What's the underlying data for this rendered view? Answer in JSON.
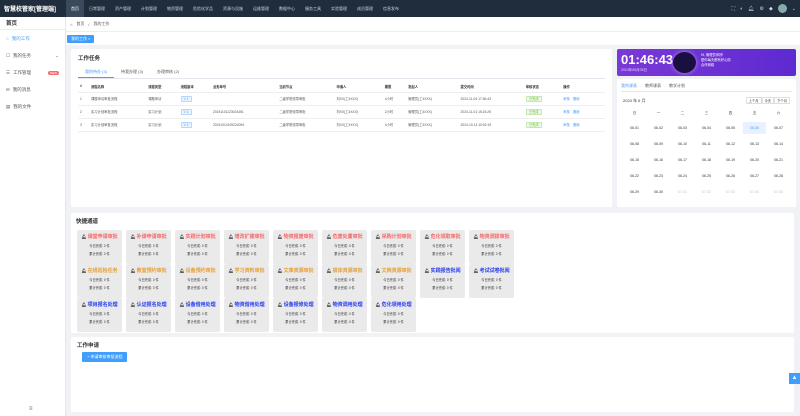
{
  "app": {
    "brand": "智慧校管家[管理端]"
  },
  "nav": [
    "首页",
    "日常管理",
    "资产管理",
    "计划管理",
    "物资管理",
    "危险化学品",
    "资源与设施",
    "运维管理",
    "数据中心",
    "服务工具",
    "实验管理",
    "成员管理",
    "信息发布"
  ],
  "sidebar": {
    "header": "首页",
    "items": [
      {
        "label": "我的工作"
      },
      {
        "label": "我的任务"
      },
      {
        "label": "工作管理",
        "badge": "NEW"
      },
      {
        "label": "我的消息"
      },
      {
        "label": "我的文件"
      }
    ]
  },
  "crumb": {
    "home": "首页",
    "current": "我的工作"
  },
  "tabbar": {
    "active": "我的工作"
  },
  "tasks": {
    "title": "工作任务",
    "tabs": [
      "我的待办 (3)",
      "待我办理 (3)",
      "办理审核 (2)"
    ],
    "columns": [
      "#",
      "流程名称",
      "流程类型",
      "流程版本",
      "业务单号",
      "当前节点",
      "申请人",
      "期限",
      "发起人",
      "提交时间",
      "审核状态",
      "操作"
    ],
    "rows": [
      [
        "1",
        "课题申请审批流程",
        "课题申请",
        "V 1",
        "",
        "二级学院领导审批",
        "刘XX(工4XXX)",
        "4小时",
        "管理员(工4XXX)",
        "2024-11-04 17:36:43",
        "已完成",
        "审核",
        "撤销"
      ],
      [
        "2",
        "实习计划审批流程",
        "实习计划",
        "V 2",
        "20241101123024451",
        "二级学院领导审批",
        "刘XX(工4XXX)",
        "2小时",
        "管理员(工4XXX)",
        "2024-11-01 15:24:25",
        "已完成",
        "审核",
        "撤销"
      ],
      [
        "3",
        "实习计划审批流程",
        "实习计划",
        "V 2",
        "20241014105224094",
        "二级学院领导审批",
        "刘XX(工4XXX)",
        "4小时",
        "管理员(工4XXX)",
        "2024-10-14 10:52:19",
        "已完成",
        "审核",
        "撤销"
      ]
    ]
  },
  "clock": {
    "time": "01:46:43",
    "date": "2024年06月05日",
    "greeting": "Hi, 管理员你好!",
    "sub1": "愿你每天都有好心情",
    "sub2": "合作网络"
  },
  "calendar": {
    "tabs": [
      "我的课表",
      "教师课表",
      "教学计划"
    ],
    "month": "2024 年 6 月",
    "buttons": [
      "上个月",
      "今天",
      "下个月"
    ],
    "weekdays": [
      "日",
      "一",
      "二",
      "三",
      "四",
      "五",
      "六"
    ],
    "rows": [
      [
        "06-01",
        "06-02",
        "06-03",
        "06-04",
        "06-05",
        "06-06",
        "06-07"
      ],
      [
        "06-08",
        "06-09",
        "06-10",
        "06-11",
        "06-12",
        "06-13",
        "06-14"
      ],
      [
        "06-15",
        "06-16",
        "06-17",
        "06-18",
        "06-19",
        "06-20",
        "06-21"
      ],
      [
        "06-22",
        "06-23",
        "06-24",
        "06-25",
        "06-26",
        "06-27",
        "06-28"
      ],
      [
        "06-29",
        "06-30",
        "07-01",
        "07-02",
        "07-03",
        "07-04",
        "07-05"
      ]
    ]
  },
  "quick": {
    "title": "快捷通道",
    "today_prefix": "今日完成: ",
    "total_prefix": "累计完成: ",
    "items": [
      {
        "label": "课堂申请审批",
        "color": "#f56c6c",
        "today": "0 件",
        "total": "0 件"
      },
      {
        "label": "补课申请审批",
        "color": "#f56c6c",
        "today": "0 件",
        "total": "0 件"
      },
      {
        "label": "实践计划审批",
        "color": "#f56c6c",
        "today": "0 件",
        "total": "0 件"
      },
      {
        "label": "增改扩建审批",
        "color": "#f56c6c",
        "today": "0 件",
        "total": "0 件"
      },
      {
        "label": "物资报废审批",
        "color": "#f56c6c",
        "today": "0 件",
        "total": "0 件"
      },
      {
        "label": "危废处置审批",
        "color": "#f56c6c",
        "today": "0 件",
        "total": "0 件"
      },
      {
        "label": "采购计划审批",
        "color": "#f56c6c",
        "today": "0 件",
        "total": "0 件"
      },
      {
        "label": "危化领取审批",
        "color": "#f56c6c",
        "today": "0 件",
        "total": "0 件"
      },
      {
        "label": "物资调拨审批",
        "color": "#f56c6c",
        "today": "0 件",
        "total": "0 件"
      },
      {
        "label": "在线巡检任务",
        "color": "#e6a23c",
        "today": "0 件",
        "total": "0 件"
      },
      {
        "label": "教室预约审批",
        "color": "#e6a23c",
        "today": "0 件",
        "total": "0 件"
      },
      {
        "label": "设备预约审批",
        "color": "#e6a23c",
        "today": "0 件",
        "total": "0 件"
      },
      {
        "label": "学习资料审批",
        "color": "#e6a23c",
        "today": "0 件",
        "total": "0 件"
      },
      {
        "label": "文章资源审批",
        "color": "#e6a23c",
        "today": "0 件",
        "total": "0 件"
      },
      {
        "label": "媒体资源审批",
        "color": "#e6a23c",
        "today": "0 件",
        "total": "0 件"
      },
      {
        "label": "文档资源审批",
        "color": "#e6a23c",
        "today": "0 件",
        "total": "0 件"
      },
      {
        "label": "实践报告批阅",
        "color": "#2b3ff0",
        "today": "0 件",
        "total": "0 件"
      },
      {
        "label": "考试试卷批阅",
        "color": "#2b3ff0",
        "today": "0 件",
        "total": "0 件"
      },
      {
        "label": "项目报名处理",
        "color": "#2b3ff0",
        "today": "0 件",
        "total": "0 件"
      },
      {
        "label": "认证报名处理",
        "color": "#2b3ff0",
        "today": "0 件",
        "total": "0 件"
      },
      {
        "label": "设备借用处理",
        "color": "#2b3ff0",
        "today": "0 件",
        "total": "0 件"
      },
      {
        "label": "物资借用处理",
        "color": "#2b3ff0",
        "today": "0 件",
        "total": "0 件"
      },
      {
        "label": "设备报修处理",
        "color": "#2b3ff0",
        "today": "0 件",
        "total": "0 件"
      },
      {
        "label": "物资调用处理",
        "color": "#2b3ff0",
        "today": "0 件",
        "total": "0 件"
      },
      {
        "label": "危化领用处理",
        "color": "#2b3ff0",
        "today": "0 件",
        "total": "0 件"
      }
    ]
  },
  "apply": {
    "title": "工作申请",
    "button": "+ 申请审核审批流程"
  }
}
